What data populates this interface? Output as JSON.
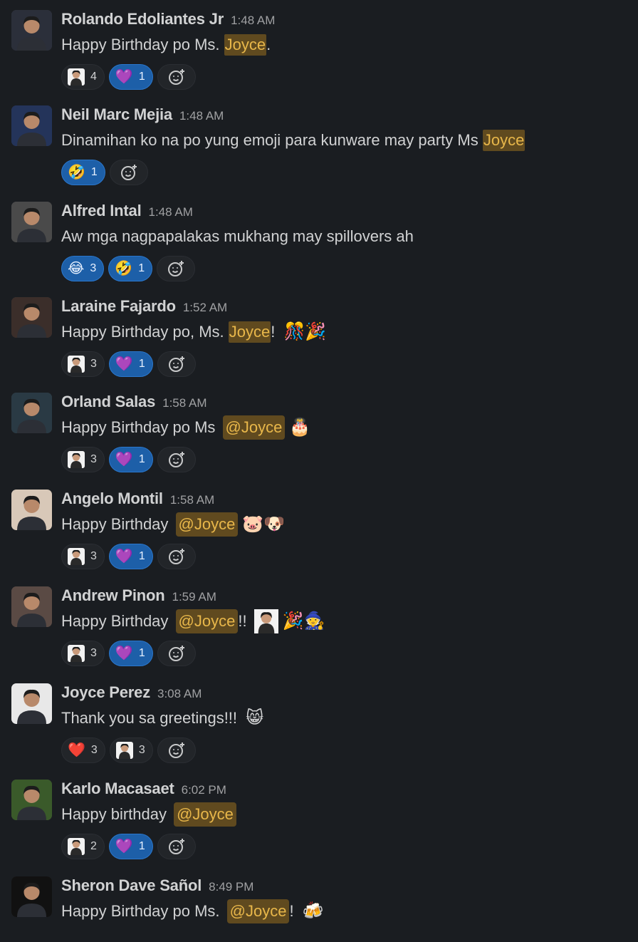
{
  "messages": [
    {
      "author": "Rolando Edoliantes Jr",
      "time": "1:48 AM",
      "parts": [
        {
          "t": "Happy Birthday po Ms. "
        },
        {
          "hl": "Joyce"
        },
        {
          "t": "."
        }
      ],
      "reactions": [
        {
          "kind": "face",
          "count": "4"
        },
        {
          "emoji": "💜",
          "count": "1",
          "mine": true
        }
      ],
      "avatar_color": "#2b2f3a"
    },
    {
      "author": "Neil Marc Mejia",
      "time": "1:48 AM",
      "parts": [
        {
          "t": "Dinamihan ko na po yung emoji para kunware may party Ms "
        },
        {
          "hl": "Joyce"
        }
      ],
      "reactions": [
        {
          "emoji": "🤣",
          "count": "1",
          "mine": true
        }
      ],
      "avatar_color": "#24345a"
    },
    {
      "author": "Alfred Intal",
      "time": "1:48 AM",
      "parts": [
        {
          "t": "Aw mga nagpapalakas mukhang may spillovers ah"
        }
      ],
      "reactions": [
        {
          "emoji": "😂",
          "count": "3",
          "mine": true
        },
        {
          "emoji": "🤣",
          "count": "1",
          "mine": true
        }
      ],
      "avatar_color": "#4a4a4a"
    },
    {
      "author": "Laraine Fajardo",
      "time": "1:52 AM",
      "parts": [
        {
          "t": "Happy Birthday po, Ms. "
        },
        {
          "hl": "Joyce"
        },
        {
          "t": "! "
        },
        {
          "emoji": "🎊🎉"
        }
      ],
      "reactions": [
        {
          "kind": "face",
          "count": "3"
        },
        {
          "emoji": "💜",
          "count": "1",
          "mine": true
        }
      ],
      "avatar_color": "#3b2e2a"
    },
    {
      "author": "Orland Salas",
      "time": "1:58 AM",
      "parts": [
        {
          "t": "Happy Birthday po Ms "
        },
        {
          "mention": "@Joyce"
        },
        {
          "emoji": "🎂"
        }
      ],
      "reactions": [
        {
          "kind": "face",
          "count": "3"
        },
        {
          "emoji": "💜",
          "count": "1",
          "mine": true
        }
      ],
      "avatar_color": "#2a3a44"
    },
    {
      "author": "Angelo Montil",
      "time": "1:58 AM",
      "parts": [
        {
          "t": "Happy Birthday "
        },
        {
          "mention": "@Joyce"
        },
        {
          "emoji": "🐷🐶"
        }
      ],
      "reactions": [
        {
          "kind": "face",
          "count": "3"
        },
        {
          "emoji": "💜",
          "count": "1",
          "mine": true
        }
      ],
      "avatar_color": "#d8c8b8"
    },
    {
      "author": "Andrew Pinon",
      "time": "1:59 AM",
      "parts": [
        {
          "t": "Happy Birthday "
        },
        {
          "mention": "@Joyce"
        },
        {
          "t": "!! "
        },
        {
          "face": true
        },
        {
          "emoji": "🎉🧙"
        }
      ],
      "reactions": [
        {
          "kind": "face",
          "count": "3"
        },
        {
          "emoji": "💜",
          "count": "1",
          "mine": true
        }
      ],
      "avatar_color": "#5a4a44"
    },
    {
      "author": "Joyce Perez",
      "time": "3:08 AM",
      "parts": [
        {
          "t": "Thank you sa greetings!!! "
        },
        {
          "emoji": "😸"
        }
      ],
      "reactions": [
        {
          "emoji": "❤️",
          "count": "3"
        },
        {
          "kind": "face",
          "count": "3"
        }
      ],
      "avatar_color": "#e8e8e8"
    },
    {
      "author": "Karlo Macasaet",
      "time": "6:02 PM",
      "parts": [
        {
          "t": "Happy birthday "
        },
        {
          "mention": "@Joyce"
        }
      ],
      "reactions": [
        {
          "kind": "face",
          "count": "2"
        },
        {
          "emoji": "💜",
          "count": "1",
          "mine": true
        }
      ],
      "avatar_color": "#3a5a2a"
    },
    {
      "author": "Sheron Dave Sañol",
      "time": "8:49 PM",
      "parts": [
        {
          "t": "Happy Birthday po Ms. "
        },
        {
          "mention": "@Joyce"
        },
        {
          "t": "! "
        },
        {
          "emoji": "🍻"
        }
      ],
      "reactions": [],
      "avatar_color": "#111111"
    }
  ]
}
